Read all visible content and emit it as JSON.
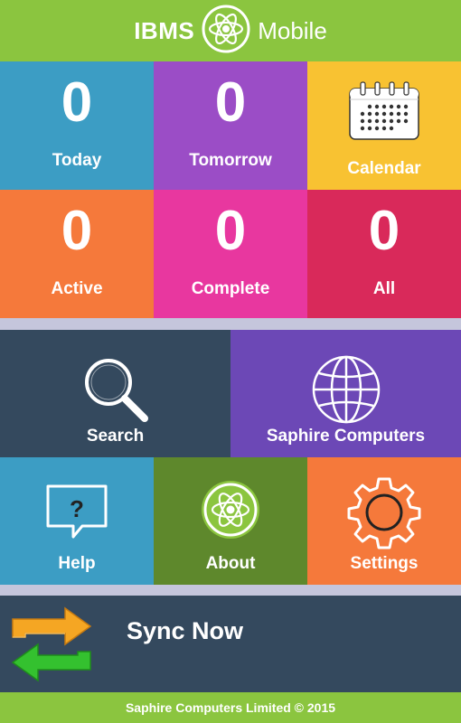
{
  "header": {
    "brand": "IBMS",
    "subtitle": "Mobile",
    "logo_icon": "atom-logo-icon",
    "bg_color": "#8bc53f"
  },
  "tiles_row1": [
    {
      "count": "0",
      "label": "Today",
      "color": "#3c9dc4"
    },
    {
      "count": "0",
      "label": "Tomorrow",
      "color": "#9b4dc6"
    },
    {
      "icon": "calendar-icon",
      "label": "Calendar",
      "color": "#f8c232"
    }
  ],
  "tiles_row2": [
    {
      "count": "0",
      "label": "Active",
      "color": "#f5793b"
    },
    {
      "count": "0",
      "label": "Complete",
      "color": "#e8379f"
    },
    {
      "count": "0",
      "label": "All",
      "color": "#d9295a"
    }
  ],
  "tiles_row3": [
    {
      "icon": "search-icon",
      "label": "Search",
      "color": "#34495e"
    },
    {
      "icon": "globe-icon",
      "label": "Saphire Computers",
      "color": "#6c48b6"
    }
  ],
  "tiles_row4": [
    {
      "icon": "help-icon",
      "label": "Help",
      "color": "#3c9dc4"
    },
    {
      "icon": "atom-logo-icon",
      "label": "About",
      "color": "#5e882c"
    },
    {
      "icon": "gear-icon",
      "label": "Settings",
      "color": "#f5793b"
    }
  ],
  "sync": {
    "label": "Sync Now",
    "icon": "sync-arrows-icon",
    "color": "#34495e"
  },
  "footer": {
    "text": "Saphire Computers Limited © 2015"
  }
}
